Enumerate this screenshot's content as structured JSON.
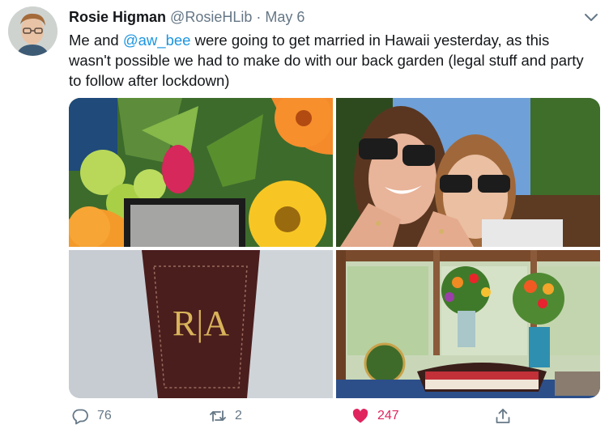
{
  "tweet": {
    "author_name": "Rosie Higman",
    "handle": "@RosieHLib",
    "separator": "·",
    "date": "May 6",
    "text_before": "Me and ",
    "mention": "@aw_bee",
    "text_after": " were going to get married in Hawaii yesterday, as this wasn't possible we had to make do with our back garden (legal stuff and party to follow after lockdown)"
  },
  "media": {
    "photo_1": "flowers-bouquet-ring-box",
    "photo_2": "couple-selfie-showing-rings",
    "photo_3": "leather-tag-monogram",
    "monogram_text": "R|A",
    "photo_4": "conservatory-flowers-cake-globe"
  },
  "actions": {
    "reply_count": "76",
    "retweet_count": "2",
    "like_count": "247",
    "like_color": "#e0245e",
    "muted_color": "#657786",
    "link_color": "#1b95e0"
  },
  "icons": {
    "menu": "chevron-down-icon",
    "reply": "reply-bubble-icon",
    "retweet": "retweet-icon",
    "like": "heart-filled-icon",
    "share": "share-upload-icon"
  }
}
